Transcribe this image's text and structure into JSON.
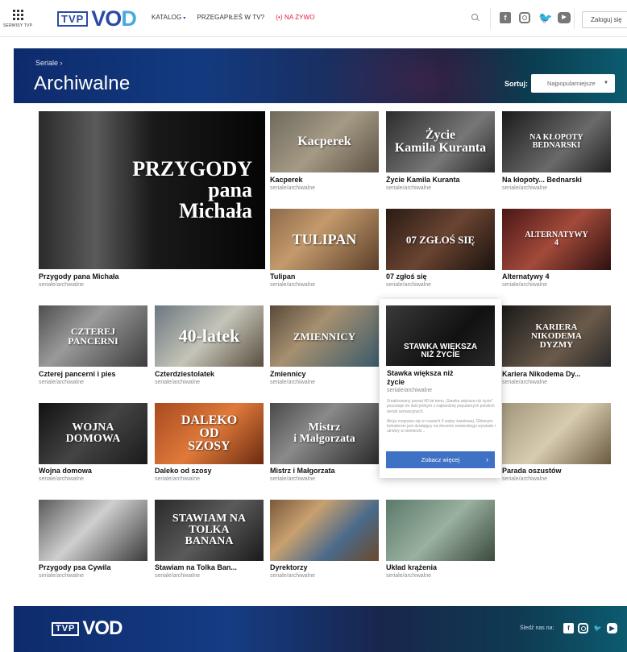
{
  "nav": {
    "services_label": "SERWISY TVP",
    "logo_tvp": "TVP",
    "logo_vo": "VO",
    "logo_d": "D",
    "links": [
      {
        "label": "KATALOG",
        "caret": "▾"
      },
      {
        "label": "PRZEGAPIŁEŚ W TV?"
      },
      {
        "label": "(•) NA ŻYWO"
      }
    ],
    "login_label": "Zaloguj się",
    "social": [
      "f",
      "",
      "t",
      "▶"
    ]
  },
  "banner": {
    "breadcrumb": "Seriale ›",
    "title": "Archiwalne",
    "sort_label": "Sortuj:",
    "sort_value": "Najpopularniejsze",
    "sort_arrow": "▼"
  },
  "tiles": [
    {
      "title": "Przygody pana Michała",
      "sub": "seriale/archiwalne",
      "thumb": "PRZYGODY\npana\nMichała"
    },
    {
      "title": "Kacperek",
      "sub": "seriale/archiwalne",
      "thumb": "Kacperek"
    },
    {
      "title": "Życie Kamila Kuranta",
      "sub": "seriale/archiwalne",
      "thumb": "Życie\nKamila Kuranta"
    },
    {
      "title": "Na kłopoty... Bednarski",
      "sub": "seriale/archiwalne",
      "thumb": "NA KŁOPOTY\nBEDNARSKI"
    },
    {
      "title": "Tulipan",
      "sub": "seriale/archiwalne",
      "thumb": "TULIPAN"
    },
    {
      "title": "07 zgłoś się",
      "sub": "seriale/archiwalne",
      "thumb": "07 ZGŁOŚ SIĘ"
    },
    {
      "title": "Alternatywy 4",
      "sub": "seriale/archiwalne",
      "thumb": "ALTERNATYWY\n4"
    },
    {
      "title": "Czterej pancerni i pies",
      "sub": "seriale/archiwalne",
      "thumb": "CZTEREJ\nPANCERNI"
    },
    {
      "title": "Czterdziestolatek",
      "sub": "seriale/archiwalne",
      "thumb": "40-latek"
    },
    {
      "title": "Zmiennicy",
      "sub": "seriale/archiwalne",
      "thumb": "ZMIENNICY"
    },
    {
      "title": "Stawka większa niż życie",
      "sub": "seriale/archiwalne",
      "thumb": "STAWKA WIĘKSZA\nNIŻ ŻYCIE"
    },
    {
      "title": "Kariera Nikodema Dy...",
      "sub": "seriale/archiwalne",
      "thumb": "KARIERA\nNIKODEMA\nDYZMY"
    },
    {
      "title": "Wojna domowa",
      "sub": "seriale/archiwalne",
      "thumb": "WOJNA\nDOMOWA"
    },
    {
      "title": "Daleko od szosy",
      "sub": "seriale/archiwalne",
      "thumb": "DALEKO\nOD\nSZOSY"
    },
    {
      "title": "Mistrz i Małgorzata",
      "sub": "seriale/archiwalne",
      "thumb": "Mistrz\ni Małgorzata"
    },
    {
      "title": "Parada oszustów",
      "sub": "seriale/archiwalne",
      "thumb": ""
    },
    {
      "title": "Przygody psa Cywila",
      "sub": "seriale/archiwalne",
      "thumb": ""
    },
    {
      "title": "Stawiam na Tolka Ban...",
      "sub": "seriale/archiwalne",
      "thumb": "STAWIAM NA\nTOLKA\nBANANA"
    },
    {
      "title": "Dyrektorzy",
      "sub": "seriale/archiwalne",
      "thumb": ""
    },
    {
      "title": "Układ krążenia",
      "sub": "seriale/archiwalne",
      "thumb": ""
    }
  ],
  "hovercard": {
    "title_line1": "Stawka większa niż",
    "title_line2": "życie",
    "sub": "seriale/archiwalne",
    "desc1": "Zrealizowany ponad 40 lat temu „Stawka większa niż życie” pozostaje do dziś jednym z najbardziej popularnych polskich seriali sensacyjnych.",
    "desc2": "Akcja rozgrywa się w czasach II wojny światowej. Głównym bohaterem jest działający na zlecenie sowieckiego wywiadu i utrwiny w niemiecki...",
    "button": "Zobacz więcej",
    "chev": "›"
  },
  "footer": {
    "logo_tvp": "TVP",
    "logo_vod": "VOD",
    "follow": "Śledź nas na:",
    "social": [
      "f",
      "",
      "t",
      "▶"
    ]
  }
}
